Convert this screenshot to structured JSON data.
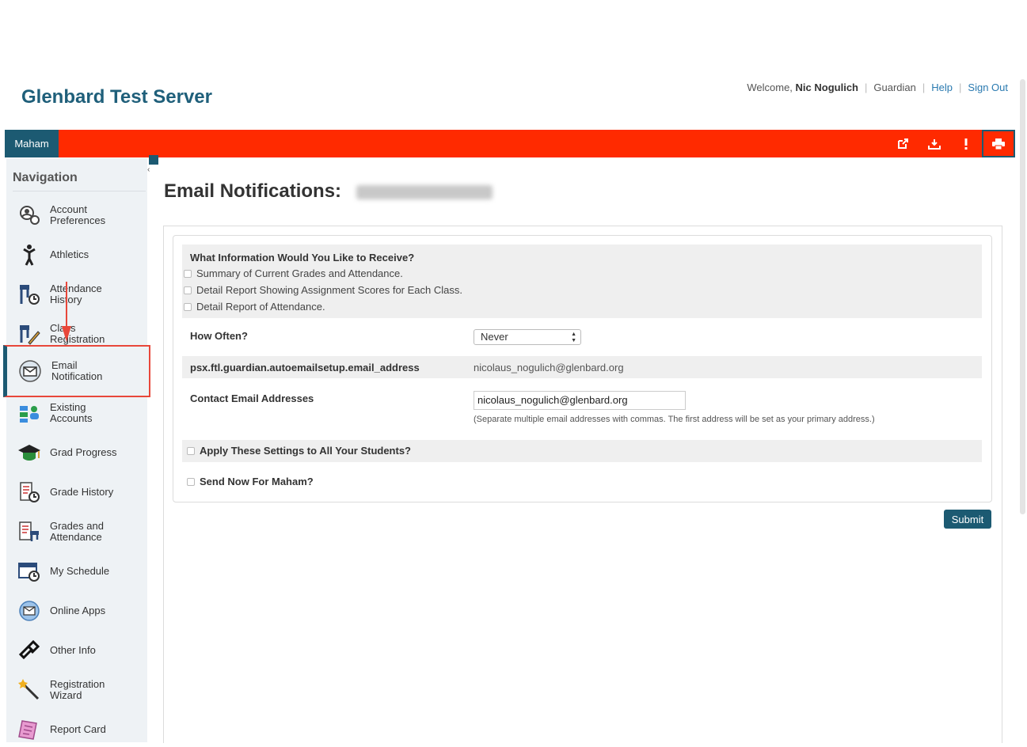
{
  "header": {
    "app_title": "Glenbard Test Server",
    "welcome_prefix": "Welcome,",
    "user_name": "Nic Nogulich",
    "user_role": "Guardian",
    "help_label": "Help",
    "signout_label": "Sign Out"
  },
  "student_bar": {
    "student_name": "Maham",
    "icons": [
      "external-link-icon",
      "download-icon",
      "alert-icon",
      "print-icon"
    ]
  },
  "sidebar": {
    "title": "Navigation",
    "items": [
      {
        "label": "Account\nPreferences",
        "icon": "account-preferences-icon"
      },
      {
        "label": "Athletics",
        "icon": "athletics-icon"
      },
      {
        "label": "Attendance\nHistory",
        "icon": "attendance-history-icon"
      },
      {
        "label": "Class\nRegistration",
        "icon": "class-registration-icon"
      },
      {
        "label": "Email\nNotification",
        "icon": "email-notification-icon"
      },
      {
        "label": "Existing\nAccounts",
        "icon": "existing-accounts-icon"
      },
      {
        "label": "Grad Progress",
        "icon": "grad-progress-icon"
      },
      {
        "label": "Grade History",
        "icon": "grade-history-icon"
      },
      {
        "label": "Grades and\nAttendance",
        "icon": "grades-attendance-icon"
      },
      {
        "label": "My Schedule",
        "icon": "my-schedule-icon"
      },
      {
        "label": "Online Apps",
        "icon": "online-apps-icon"
      },
      {
        "label": "Other Info",
        "icon": "other-info-icon"
      },
      {
        "label": "Registration\nWizard",
        "icon": "registration-wizard-icon"
      },
      {
        "label": "Report Card",
        "icon": "report-card-icon"
      }
    ],
    "active_index": 4
  },
  "page": {
    "title": "Email Notifications:"
  },
  "form": {
    "section_title": "What Information Would You Like to Receive?",
    "options": [
      "Summary of Current Grades and Attendance.",
      "Detail Report Showing Assignment Scores for Each Class.",
      "Detail Report of Attendance."
    ],
    "how_often_label": "How Often?",
    "how_often_value": "Never",
    "auto_email_label": "psx.ftl.guardian.autoemailsetup.email_address",
    "auto_email_value": "nicolaus_nogulich@glenbard.org",
    "contact_label": "Contact Email Addresses",
    "contact_value": "nicolaus_nogulich@glenbard.org",
    "contact_hint": "(Separate multiple email addresses with commas. The first address will be set as your primary address.)",
    "apply_all_label": "Apply These Settings to All Your Students?",
    "send_now_label": "Send Now For Maham?",
    "submit_label": "Submit"
  },
  "colors": {
    "brand_teal": "#1c5a72",
    "student_bar_red": "#ff2a00",
    "annotation_red": "#e8473a"
  }
}
